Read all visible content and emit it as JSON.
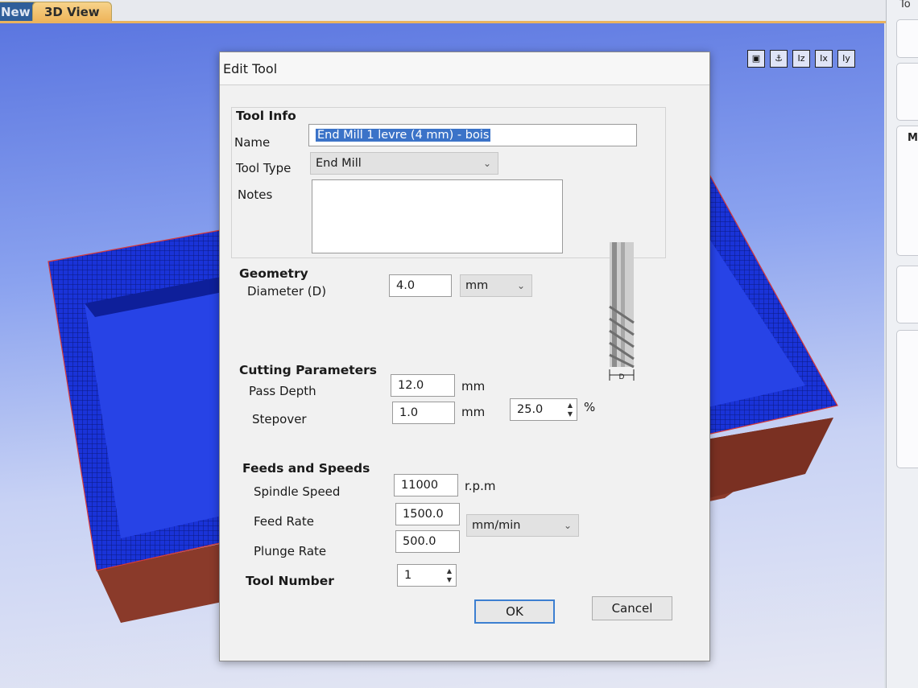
{
  "tabs": [
    {
      "label": "New",
      "active": false
    },
    {
      "label": "3D View",
      "active": true
    }
  ],
  "view_toolbar": {
    "icons": [
      "fit-view-icon",
      "anchor-icon",
      "iz-icon",
      "ix-icon",
      "iy-icon"
    ],
    "labels": [
      "▣",
      "⚓",
      "Iz",
      "Ix",
      "Iy"
    ]
  },
  "right_panel": {
    "header": "To",
    "section_label": "M"
  },
  "dialog": {
    "title": "Edit Tool",
    "tool_info": {
      "heading": "Tool Info",
      "name_label": "Name",
      "name_value": "End Mill 1 levre (4 mm) - bois",
      "tool_type_label": "Tool Type",
      "tool_type_value": "End Mill",
      "notes_label": "Notes",
      "notes_value": ""
    },
    "geometry": {
      "heading": "Geometry",
      "diameter_label": "Diameter (D)",
      "diameter_value": "4.0",
      "units_value": "mm",
      "diagram_label": "D"
    },
    "cutting": {
      "heading": "Cutting Parameters",
      "pass_depth_label": "Pass Depth",
      "pass_depth_value": "12.0",
      "pass_depth_unit": "mm",
      "stepover_label": "Stepover",
      "stepover_value": "1.0",
      "stepover_unit": "mm",
      "stepover_percent_value": "25.0",
      "stepover_percent_unit": "%"
    },
    "feeds": {
      "heading": "Feeds and Speeds",
      "spindle_label": "Spindle Speed",
      "spindle_value": "11000",
      "spindle_unit": "r.p.m",
      "feed_label": "Feed Rate",
      "feed_value": "1500.0",
      "plunge_label": "Plunge Rate",
      "plunge_value": "500.0",
      "rate_units_value": "mm/min"
    },
    "tool_number": {
      "label": "Tool Number",
      "value": "1"
    },
    "buttons": {
      "ok": "OK",
      "cancel": "Cancel"
    }
  },
  "colors": {
    "viewport_blue": "#5b76e0",
    "wood": "#8a3a2a",
    "accent": "#3c7fd1"
  }
}
